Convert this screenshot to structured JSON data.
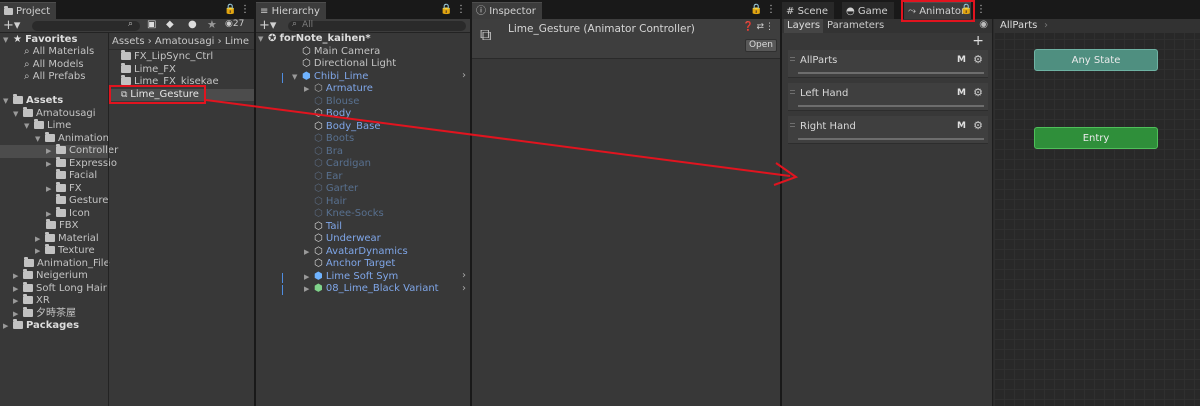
{
  "project": {
    "tab_label": "Project",
    "badge_count": "27",
    "favorites_label": "Favorites",
    "favorites": [
      "All Materials",
      "All Models",
      "All Prefabs"
    ],
    "assets_label": "Assets",
    "tree": [
      "Amatousagi",
      "Lime",
      "Animation",
      "Controller",
      "Expressio",
      "Facial",
      "FX",
      "Gesture",
      "Icon",
      "FBX",
      "Material",
      "Texture",
      "Animation_File",
      "Neigerium",
      "Soft Long Hair",
      "XR",
      "夕時茶屋"
    ],
    "packages_label": "Packages",
    "breadcrumb": [
      "Assets",
      "Amatousagi",
      "Lime"
    ],
    "files": [
      "FX_LipSync_Ctrl",
      "Lime_FX",
      "Lime_FX_kisekae",
      "Lime_Gesture"
    ]
  },
  "hierarchy": {
    "tab_label": "Hierarchy",
    "search_placeholder": "All",
    "scene_name": "forNote_kaihen*",
    "items": [
      "Main Camera",
      "Directional Light",
      "Chibi_Lime",
      "Armature",
      "Blouse",
      "Body",
      "Body_Base",
      "Boots",
      "Bra",
      "Cardigan",
      "Ear",
      "Garter",
      "Hair",
      "Knee-Socks",
      "Tail",
      "Underwear",
      "AvatarDynamics",
      "Anchor Target",
      "Lime Soft Sym",
      "08_Lime_Black Variant"
    ]
  },
  "inspector": {
    "tab_label": "Inspector",
    "title": "Lime_Gesture (Animator Controller)",
    "open_label": "Open"
  },
  "animator": {
    "tabs": [
      "Scene",
      "Game",
      "Animator"
    ],
    "sub_tabs": [
      "Layers",
      "Parameters"
    ],
    "breadcrumb": "AllParts",
    "add_label": "+",
    "layers": [
      {
        "name": "AllParts",
        "m": "M"
      },
      {
        "name": "Left Hand",
        "m": "M"
      },
      {
        "name": "Right Hand",
        "m": "M"
      }
    ],
    "states": {
      "any_state": "Any State",
      "entry": "Entry"
    },
    "colors": {
      "any_state": "#4f8f80",
      "entry": "#2f8f3a",
      "highlight": "#e1141f"
    }
  }
}
